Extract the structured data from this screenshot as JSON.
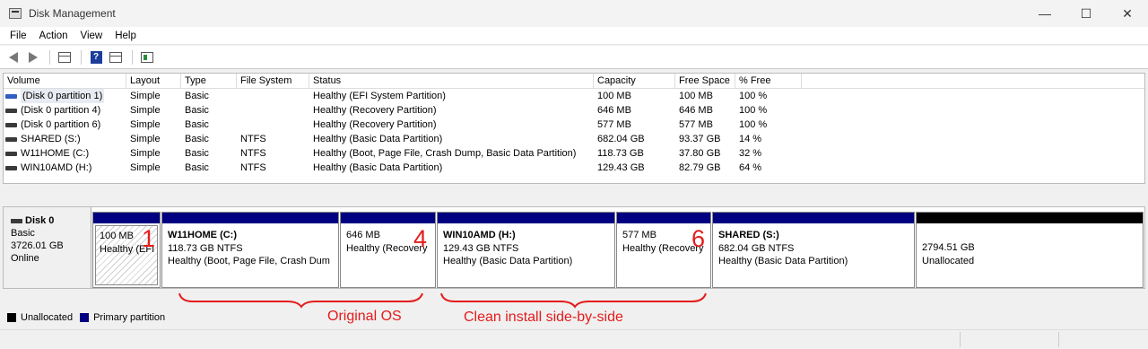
{
  "window": {
    "title": "Disk Management",
    "controls": [
      "—",
      "☐",
      "✕"
    ]
  },
  "menu": [
    "File",
    "Action",
    "View",
    "Help"
  ],
  "toolbar": {
    "help_label": "?"
  },
  "columns": [
    "Volume",
    "Layout",
    "Type",
    "File System",
    "Status",
    "Capacity",
    "Free Space",
    "% Free"
  ],
  "volumes": [
    {
      "volume": "(Disk 0 partition 1)",
      "layout": "Simple",
      "type": "Basic",
      "fs": "",
      "status": "Healthy (EFI System Partition)",
      "capacity": "100 MB",
      "free": "100 MB",
      "pct": "100 %"
    },
    {
      "volume": "(Disk 0 partition 4)",
      "layout": "Simple",
      "type": "Basic",
      "fs": "",
      "status": "Healthy (Recovery Partition)",
      "capacity": "646 MB",
      "free": "646 MB",
      "pct": "100 %"
    },
    {
      "volume": "(Disk 0 partition 6)",
      "layout": "Simple",
      "type": "Basic",
      "fs": "",
      "status": "Healthy (Recovery Partition)",
      "capacity": "577 MB",
      "free": "577 MB",
      "pct": "100 %"
    },
    {
      "volume": "SHARED (S:)",
      "layout": "Simple",
      "type": "Basic",
      "fs": "NTFS",
      "status": "Healthy (Basic Data Partition)",
      "capacity": "682.04 GB",
      "free": "93.37 GB",
      "pct": "14 %"
    },
    {
      "volume": "W11HOME (C:)",
      "layout": "Simple",
      "type": "Basic",
      "fs": "NTFS",
      "status": "Healthy (Boot, Page File, Crash Dump, Basic Data Partition)",
      "capacity": "118.73 GB",
      "free": "37.80 GB",
      "pct": "32 %"
    },
    {
      "volume": "WIN10AMD (H:)",
      "layout": "Simple",
      "type": "Basic",
      "fs": "NTFS",
      "status": "Healthy (Basic Data Partition)",
      "capacity": "129.43 GB",
      "free": "82.79 GB",
      "pct": "64 %"
    }
  ],
  "disk": {
    "name": "Disk 0",
    "type": "Basic",
    "size": "3726.01 GB",
    "state": "Online"
  },
  "partitions": [
    {
      "name": "",
      "size": "100 MB",
      "status": "Healthy (EFI"
    },
    {
      "name": "W11HOME  (C:)",
      "size": "118.73 GB NTFS",
      "status": "Healthy (Boot, Page File, Crash Dum"
    },
    {
      "name": "",
      "size": "646 MB",
      "status": "Healthy (Recovery"
    },
    {
      "name": "WIN10AMD  (H:)",
      "size": "129.43 GB NTFS",
      "status": "Healthy (Basic Data Partition)"
    },
    {
      "name": "",
      "size": "577 MB",
      "status": "Healthy (Recovery"
    },
    {
      "name": "SHARED  (S:)",
      "size": "682.04 GB NTFS",
      "status": "Healthy (Basic Data Partition)"
    },
    {
      "name": "",
      "size": "2794.51 GB",
      "status": "Unallocated"
    }
  ],
  "annotations": {
    "n1": "1",
    "n4": "4",
    "n6": "6",
    "original": "Original OS",
    "clean": "Clean install side-by-side",
    "color": "#e41b1b"
  },
  "legend": [
    {
      "label": "Unallocated",
      "color": "#000000"
    },
    {
      "label": "Primary partition",
      "color": "#000080"
    }
  ]
}
